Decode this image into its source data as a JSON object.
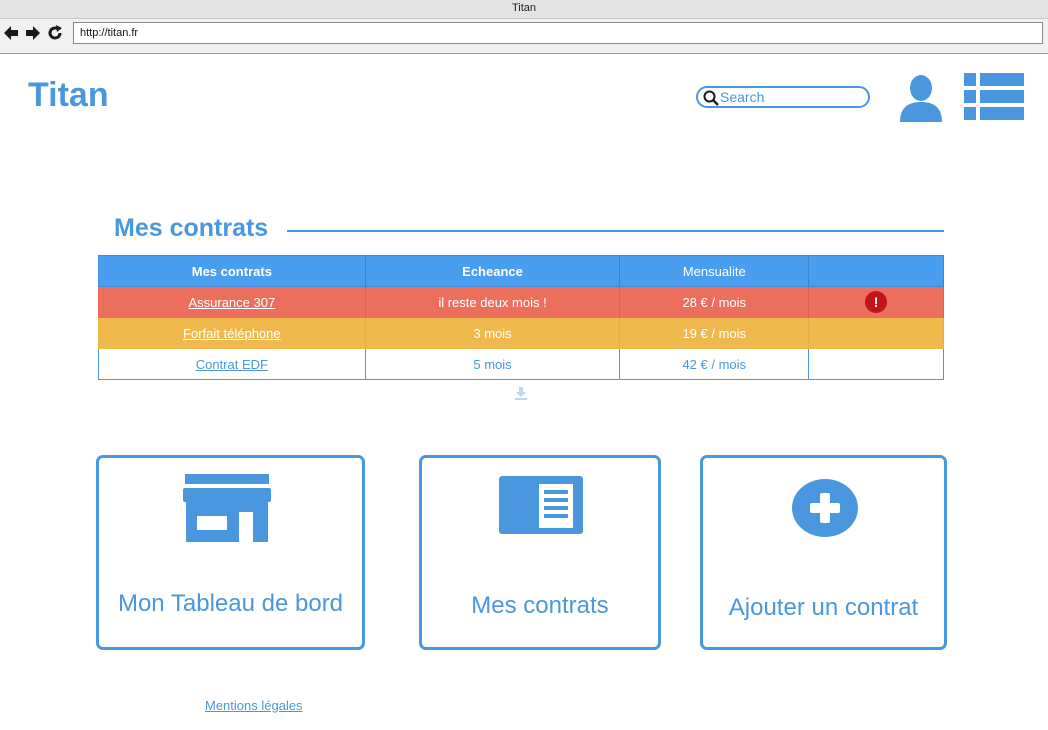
{
  "browser": {
    "window_title": "Titan",
    "back_icon": "arrow-left-icon",
    "forward_icon": "arrow-right-icon",
    "reload_icon": "reload-icon",
    "url": "http://titan.fr"
  },
  "header": {
    "logo": "Titan",
    "search": {
      "placeholder": "Search",
      "value": "",
      "icon": "search-icon"
    },
    "user_icon": "user-icon",
    "menu_icon": "list-menu-icon"
  },
  "contracts_section": {
    "title": "Mes contrats",
    "table": {
      "headers": [
        "Mes contrats",
        "Echeance",
        "Mensualite",
        ""
      ],
      "rows": [
        {
          "name": "Assurance 307",
          "echeance": "il reste deux mois !",
          "mensualite": "28 € / mois",
          "status": "alert",
          "badge": "!"
        },
        {
          "name": "Forfait téléphone",
          "echeance": "3 mois",
          "mensualite": "19 € / mois",
          "status": "warning"
        },
        {
          "name": "Contrat EDF",
          "echeance": "5 mois",
          "mensualite": "42 € / mois",
          "status": "ok"
        }
      ]
    },
    "expand_icon": "download-arrow-icon"
  },
  "cards": [
    {
      "label": "Mon Tableau de bord",
      "icon": "store-icon"
    },
    {
      "label": "Mes contrats",
      "icon": "document-icon"
    },
    {
      "label": "Ajouter un contrat",
      "icon": "plus-circle-icon"
    }
  ],
  "footer": {
    "legal_link": "Mentions légales"
  },
  "colors": {
    "accent": "#4a97df",
    "header_row": "#4a9ef0",
    "alert_row": "#ec6e5c",
    "warning_row": "#efb94e",
    "alert_badge": "#c2141c"
  }
}
